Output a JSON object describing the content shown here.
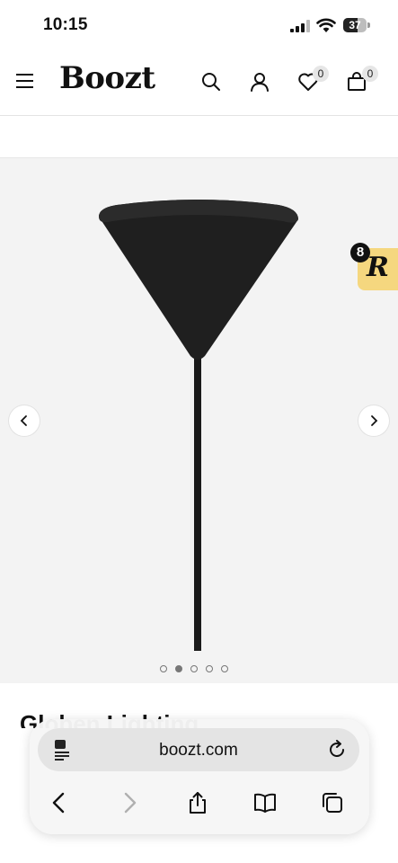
{
  "status_bar": {
    "time": "10:15",
    "battery": "37"
  },
  "header": {
    "logo": "Boozt",
    "wishlist_count": "0",
    "bag_count": "0"
  },
  "gallery": {
    "dot_count": 5,
    "active_dot": 2
  },
  "reviews_widget": {
    "count": "8",
    "letter": "R"
  },
  "product": {
    "title_peek": "Globen Lighting"
  },
  "browser": {
    "url": "boozt.com"
  },
  "colors": {
    "gallery_bg": "#f3f3f3",
    "reviews_bg": "#f5d77f"
  }
}
